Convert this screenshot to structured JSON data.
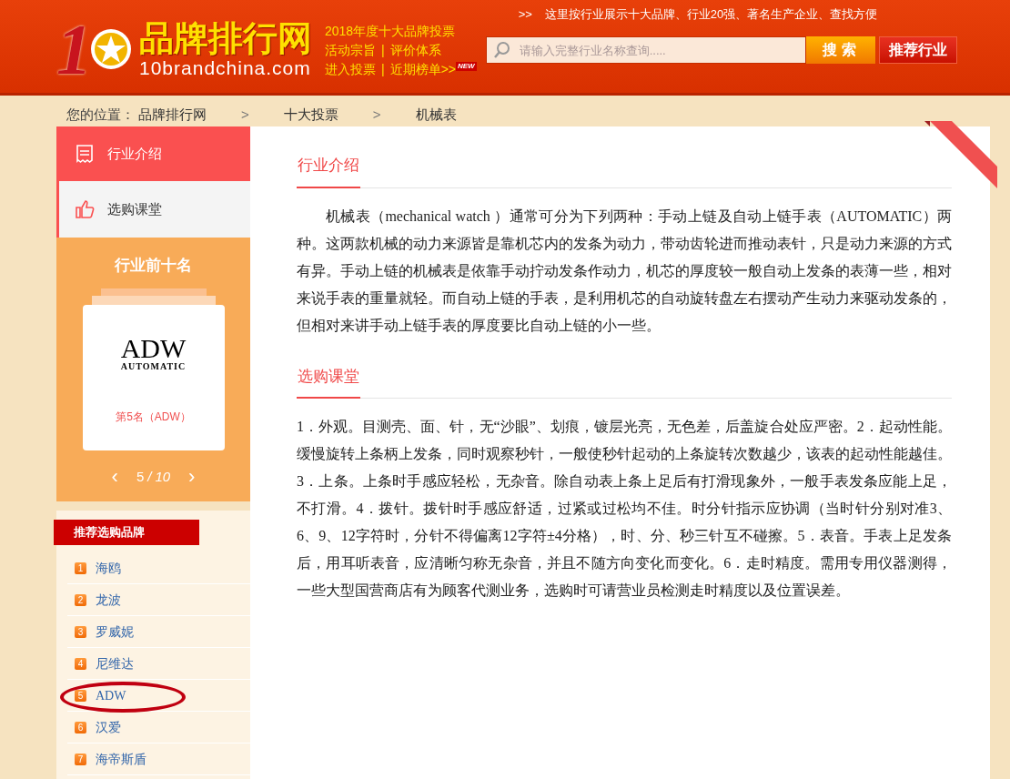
{
  "header": {
    "logo_number": "1",
    "logo_title": "品牌排行网",
    "logo_domain": "10brandchina.com",
    "vote_link": "2018年度十大品牌投票",
    "links": [
      [
        "活动宗旨",
        "评价体系"
      ],
      [
        "进入投票",
        "近期榜单>>"
      ]
    ],
    "link_divider": "|",
    "new_badge": "NEW",
    "tagline_arrow": ">>",
    "tagline": "这里按行业展示十大品牌、行业20强、著名生产企业、查找方便",
    "search": {
      "placeholder": "请输入完整行业名称查询....."
    },
    "search_button": "搜 索",
    "recommend_button": "推荐行业"
  },
  "breadcrumb": {
    "label": "您的位置：",
    "items": [
      "品牌排行网",
      "十大投票",
      "机械表"
    ],
    "separator": ">"
  },
  "sidebar": {
    "tabs": [
      {
        "label": "行业介绍",
        "selected": true
      },
      {
        "label": "选购课堂",
        "selected": false
      }
    ],
    "top_ten": {
      "title": "行业前十名",
      "logo_text": "ADW",
      "logo_subtext": "AUTOMATIC",
      "caption": "第5名（ADW）",
      "prev": "‹",
      "page": "5",
      "page_separator": "/",
      "total": "10",
      "next": "›"
    },
    "brands": {
      "title": "推荐选购品牌",
      "items": [
        {
          "rank": "1",
          "name": "海鸥",
          "circled": false
        },
        {
          "rank": "2",
          "name": "龙波",
          "circled": false
        },
        {
          "rank": "3",
          "name": "罗威妮",
          "circled": false
        },
        {
          "rank": "4",
          "name": "尼维达",
          "circled": false
        },
        {
          "rank": "5",
          "name": "ADW",
          "circled": true
        },
        {
          "rank": "6",
          "name": "汉爱",
          "circled": false
        },
        {
          "rank": "7",
          "name": "海帝斯盾",
          "circled": false
        }
      ]
    }
  },
  "sections": [
    {
      "title": "行业介绍",
      "indent": true,
      "text": "机械表（mechanical watch ）通常可分为下列两种：手动上链及自动上链手表（AUTOMATIC）两种。这两款机械的动力来源皆是靠机芯内的发条为动力，带动齿轮进而推动表针，只是动力来源的方式有异。手动上链的机械表是依靠手动拧动发条作动力，机芯的厚度较一般自动上发条的表薄一些，相对来说手表的重量就轻。而自动上链的手表，是利用机芯的自动旋转盘左右摆动产生动力来驱动发条的，但相对来讲手动上链手表的厚度要比自动上链的小一些。"
    },
    {
      "title": "选购课堂",
      "indent": false,
      "text": "1．外观。目测壳、面、针，无“沙眼”、划痕，镀层光亮，无色差，后盖旋合处应严密。2．起动性能。缓慢旋转上条柄上发条，同时观察秒针，一般使秒针起动的上条旋转次数越少，该表的起动性能越佳。3．上条。上条时手感应轻松，无杂音。除自动表上条上足后有打滑现象外，一般手表发条应能上足，不打滑。4．拨针。拨针时手感应舒适，过紧或过松均不佳。时分针指示应协调（当时针分别对准3、6、9、12字符时，分针不得偏离12字符±4分格），时、分、秒三针互不碰擦。5．表音。手表上足发条后，用耳听表音，应清晰匀称无杂音，并且不随方向变化而变化。6．走时精度。需用专用仪器测得，一些大型国营商店有为顾客代测业务，选购时可请营业员检测走时精度以及位置误差。"
    }
  ]
}
